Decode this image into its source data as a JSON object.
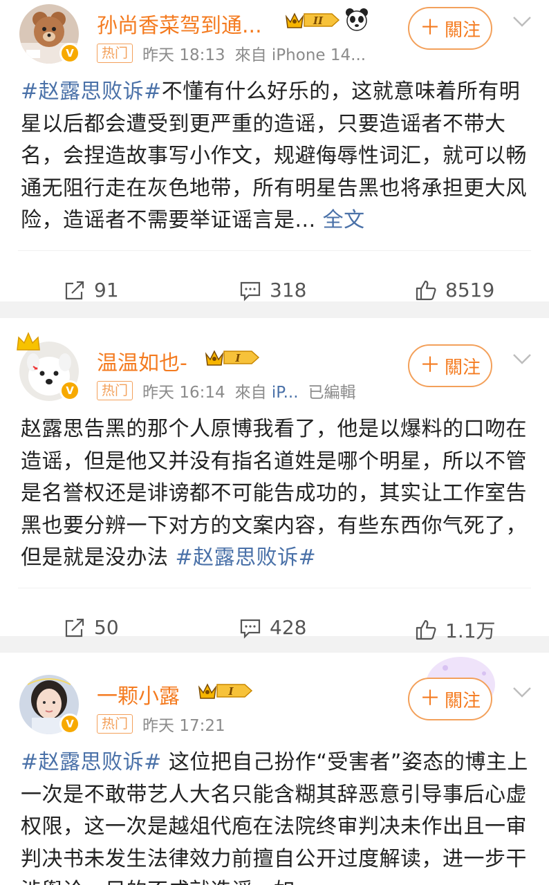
{
  "posts": [
    {
      "username": "孙尚香菜驾到通...",
      "level": "II",
      "hot_label": "热门",
      "time": "昨天 18:13",
      "source": "來自 iPhone 14...",
      "edited": "",
      "follow_label": "關注",
      "topic_prefix": "#赵露思败诉#",
      "text": "不懂有什么好乐的，这就意味着所有明星以后都会遭受到更严重的造谣，只要造谣者不带大名，会捏造故事写小作文，规避侮辱性词汇，就可以畅通无阻行走在灰色地带，所有明星告黑也将承担更大风险，造谣者不需要举证谣言是...",
      "more_label": " 全文",
      "reposts": "91",
      "comments": "318",
      "likes": "8519"
    },
    {
      "username": "温温如也-",
      "level": "I",
      "hot_label": "热门",
      "time": "昨天 16:14",
      "source": "來自 ",
      "source_link": "iP...",
      "edited": "已編輯",
      "follow_label": "關注",
      "text": "赵露思告黑的那个人原博我看了，他是以爆料的口吻在造谣，但是他又并没有指名道姓是哪个明星，所以不管是名誉权还是诽谤都不可能告成功的，其实让工作室告黑也要分辨一下对方的文案内容，有些东西你气死了，但是就是没办法 ",
      "topic_suffix": "#赵露思败诉#",
      "reposts": "50",
      "comments": "428",
      "likes": "1.1万"
    },
    {
      "username": "一颗小露",
      "level": "I",
      "hot_label": "热门",
      "time": "昨天 17:21",
      "follow_label": "關注",
      "topic_prefix": "#赵露思败诉#",
      "text": " 这位把自己扮作“受害者”姿态的博主上一次是不敢带艺人大名只能含糊其辞恶意引导事后心虚权限，这一次是越俎代庖在法院终审判决未作出且一审判决书未发生法律效力前擅自公开过度解读，进一步干涉舆论，目的不成就造谣，如"
    }
  ],
  "colors": {
    "accent": "#f47b20",
    "link": "#4a71a8",
    "separator": "#f2f2f2"
  },
  "icons": [
    "repost-icon",
    "comment-icon",
    "like-icon",
    "chevron-down-icon",
    "crown-icon",
    "panda-icon",
    "verified-icon"
  ]
}
